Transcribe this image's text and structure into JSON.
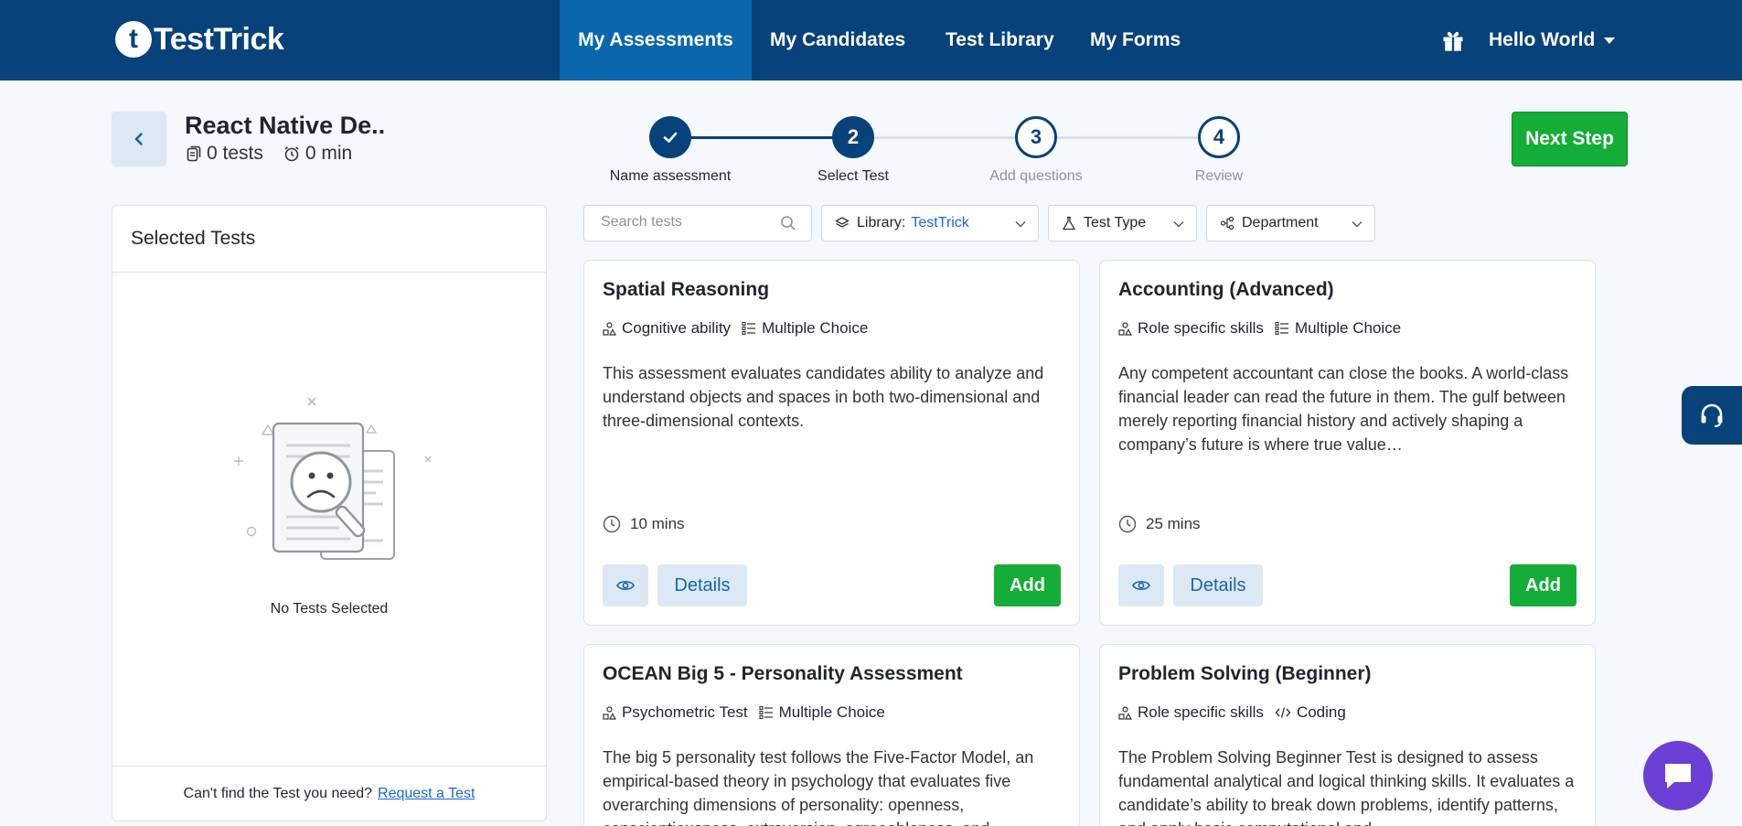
{
  "brand": {
    "name": "TestTrick",
    "mark": "t"
  },
  "nav": {
    "items": [
      {
        "label": "My Assessments",
        "active": true
      },
      {
        "label": "My Candidates",
        "active": false
      },
      {
        "label": "Test Library",
        "active": false
      },
      {
        "label": "My Forms",
        "active": false
      }
    ],
    "user_label": "Hello World"
  },
  "assessment": {
    "title": "React Native De..",
    "tests_count": "0 tests",
    "duration": "0 min"
  },
  "stepper": {
    "steps": [
      {
        "number": "",
        "label": "Name assessment",
        "state": "done"
      },
      {
        "number": "2",
        "label": "Select Test",
        "state": "current"
      },
      {
        "number": "3",
        "label": "Add questions",
        "state": "todo"
      },
      {
        "number": "4",
        "label": "Review",
        "state": "todo"
      }
    ]
  },
  "next_button": "Next Step",
  "selected_panel": {
    "title": "Selected Tests",
    "empty_text": "No Tests Selected",
    "footer_text": "Can't find the Test you need?",
    "footer_link": "Request a Test"
  },
  "filters": {
    "search_placeholder": "Search tests",
    "library_label": "Library:",
    "library_value": "TestTrick",
    "test_type": "Test Type",
    "department": "Department"
  },
  "cards": [
    {
      "title": "Spatial Reasoning",
      "category": "Cognitive ability",
      "format": "Multiple Choice",
      "format_icon": "list-icon",
      "description": "This assessment evaluates candidates ability to analyze and understand objects and spaces in both two-dimensional and three-dimensional contexts.",
      "duration": "10 mins",
      "details_label": "Details",
      "add_label": "Add"
    },
    {
      "title": "Accounting (Advanced)",
      "category": "Role specific skills",
      "format": "Multiple Choice",
      "format_icon": "list-icon",
      "description": "Any competent accountant can close the books. A world-class financial leader can read the future in them. The gulf between merely reporting financial history and actively shaping a company’s future is where true value…",
      "duration": "25 mins",
      "details_label": "Details",
      "add_label": "Add"
    },
    {
      "title": "OCEAN Big 5 - Personality Assessment",
      "category": "Psychometric Test",
      "format": "Multiple Choice",
      "format_icon": "list-icon",
      "description": "The big 5 personality test follows the Five-Factor Model, an empirical-based theory in psychology that evaluates five overarching dimensions of personality: openness, conscientiousness, extraversion, agreeableness, and",
      "duration": "",
      "details_label": "Details",
      "add_label": "Add"
    },
    {
      "title": "Problem Solving (Beginner)",
      "category": "Role specific skills",
      "format": "Coding",
      "format_icon": "code-icon",
      "description": "The Problem Solving Beginner Test is designed to assess fundamental analytical and logical thinking skills. It evaluates a candidate’s ability to break down problems, identify patterns, and apply basic computational and",
      "duration": "",
      "details_label": "Details",
      "add_label": "Add"
    }
  ],
  "colors": {
    "nav_bg": "#07427a",
    "nav_active": "#0a67ad",
    "accent_green": "#13ad37",
    "link_blue": "#1668d8",
    "chat_purple": "#6b3fd6"
  }
}
